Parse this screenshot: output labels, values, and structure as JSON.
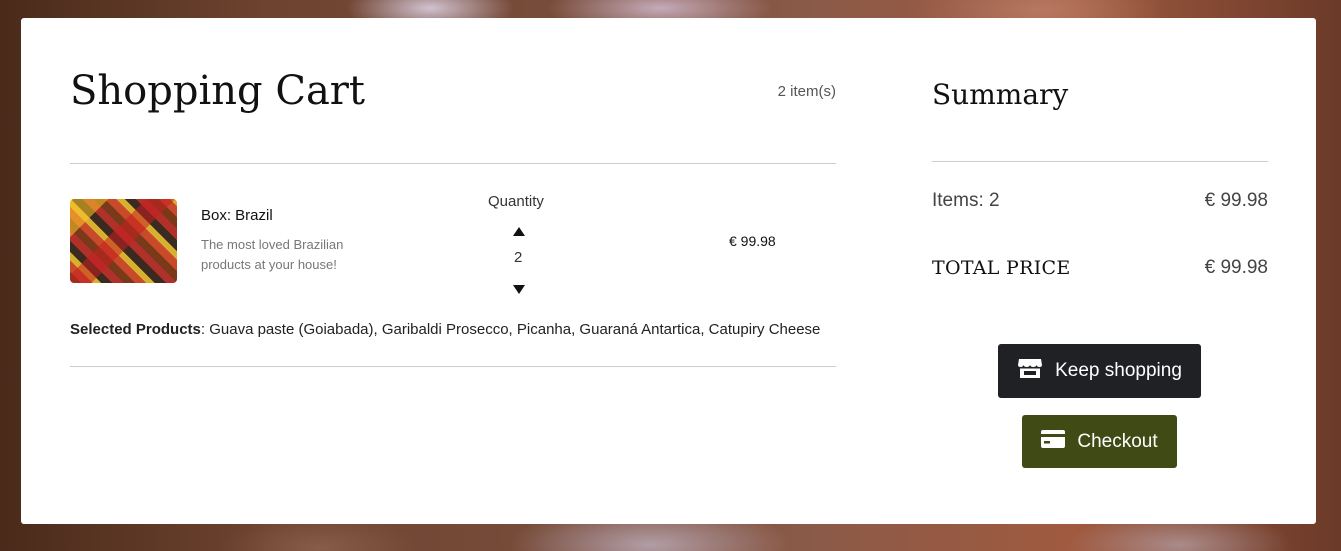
{
  "cart": {
    "title": "Shopping Cart",
    "item_count": "2 item(s)",
    "item": {
      "name": "Box: Brazil",
      "description": "The most loved Brazilian products at your house!",
      "quantity_label": "Quantity",
      "quantity": "2",
      "price": "€ 99.98"
    },
    "selected_label": "Selected Products",
    "selected_products": ": Guava paste (Goiabada), Garibaldi Prosecco, Picanha, Guaraná Antartica, Catupiry Cheese"
  },
  "summary": {
    "title": "Summary",
    "items_label": "Items: 2",
    "items_value": "€ 99.98",
    "total_label": "TOTAL PRICE",
    "total_value": "€ 99.98"
  },
  "buttons": {
    "keep_shopping": "Keep shopping",
    "checkout": "Checkout"
  },
  "icons": {
    "keep_shopping": "store-icon",
    "checkout": "credit-card-icon",
    "quantity_up": "triangle-up-icon",
    "quantity_down": "triangle-down-icon"
  },
  "colors": {
    "keep_shopping_bg": "#1f2125",
    "checkout_bg": "#404a14"
  }
}
